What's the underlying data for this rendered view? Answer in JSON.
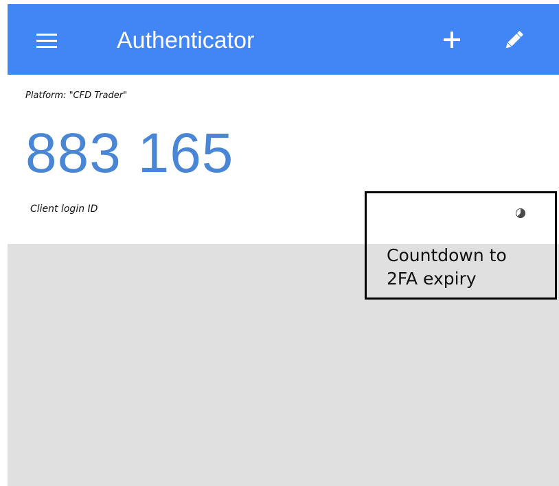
{
  "appbar": {
    "title": "Authenticator",
    "menu_icon": "hamburger-menu-icon",
    "add_icon": "plus-icon",
    "edit_icon": "pencil-icon",
    "color": "#4285f4"
  },
  "account": {
    "platform_label": "Platform: \"CFD Trader\"",
    "code": "883 165",
    "client_label": "Client login ID",
    "code_color": "#4a86d6",
    "timer_icon": "countdown-pie-icon"
  },
  "annotation": {
    "callout_text_line1": "Countdown to",
    "callout_text_line2": "2FA expiry"
  }
}
